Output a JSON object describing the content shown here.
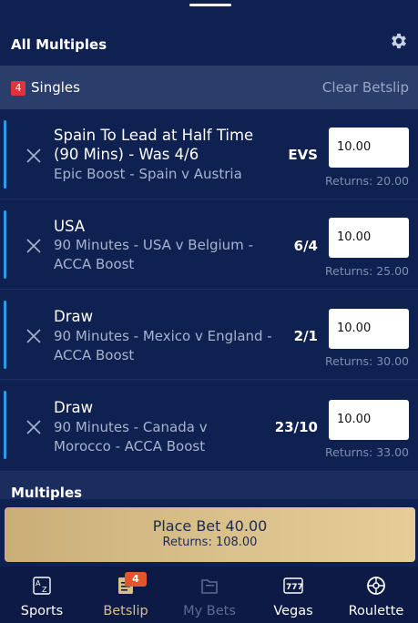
{
  "header": {
    "title": "All Multiples",
    "settings_icon": "gear-icon"
  },
  "singles": {
    "count": "4",
    "label": "Singles",
    "clear_label": "Clear Betslip"
  },
  "bets": [
    {
      "selection": "Spain To Lead at Half Time (90 Mins) - Was 4/6",
      "market": "Epic Boost - Spain v Austria",
      "odds": "EVS",
      "stake": "10.00",
      "returns": "Returns: 20.00"
    },
    {
      "selection": "USA",
      "market": "90 Minutes - USA v Belgium - ACCA Boost",
      "odds": "6/4",
      "stake": "10.00",
      "returns": "Returns: 25.00"
    },
    {
      "selection": "Draw",
      "market": "90 Minutes - Mexico v England - ACCA Boost",
      "odds": "2/1",
      "stake": "10.00",
      "returns": "Returns: 30.00"
    },
    {
      "selection": "Draw",
      "market": "90 Minutes - Canada v Morocco - ACCA Boost",
      "odds": "23/10",
      "stake": "10.00",
      "returns": "Returns: 33.00"
    }
  ],
  "multiples": {
    "label": "Multiples"
  },
  "place_bet": {
    "label": "Place Bet 40.00",
    "returns": "Returns: 108.00"
  },
  "tabs": [
    {
      "label": "Sports",
      "icon": "sports-az-icon"
    },
    {
      "label": "Betslip",
      "icon": "betslip-icon",
      "badge": "4",
      "active": true
    },
    {
      "label": "My Bets",
      "icon": "my-bets-icon",
      "disabled": true
    },
    {
      "label": "Vegas",
      "icon": "slot-777-icon"
    },
    {
      "label": "Roulette",
      "icon": "roulette-icon"
    }
  ],
  "colors": {
    "background": "#0f2150",
    "accent": "#2e9be8",
    "gold": "#d9c08a",
    "badge": "#e0333c"
  }
}
